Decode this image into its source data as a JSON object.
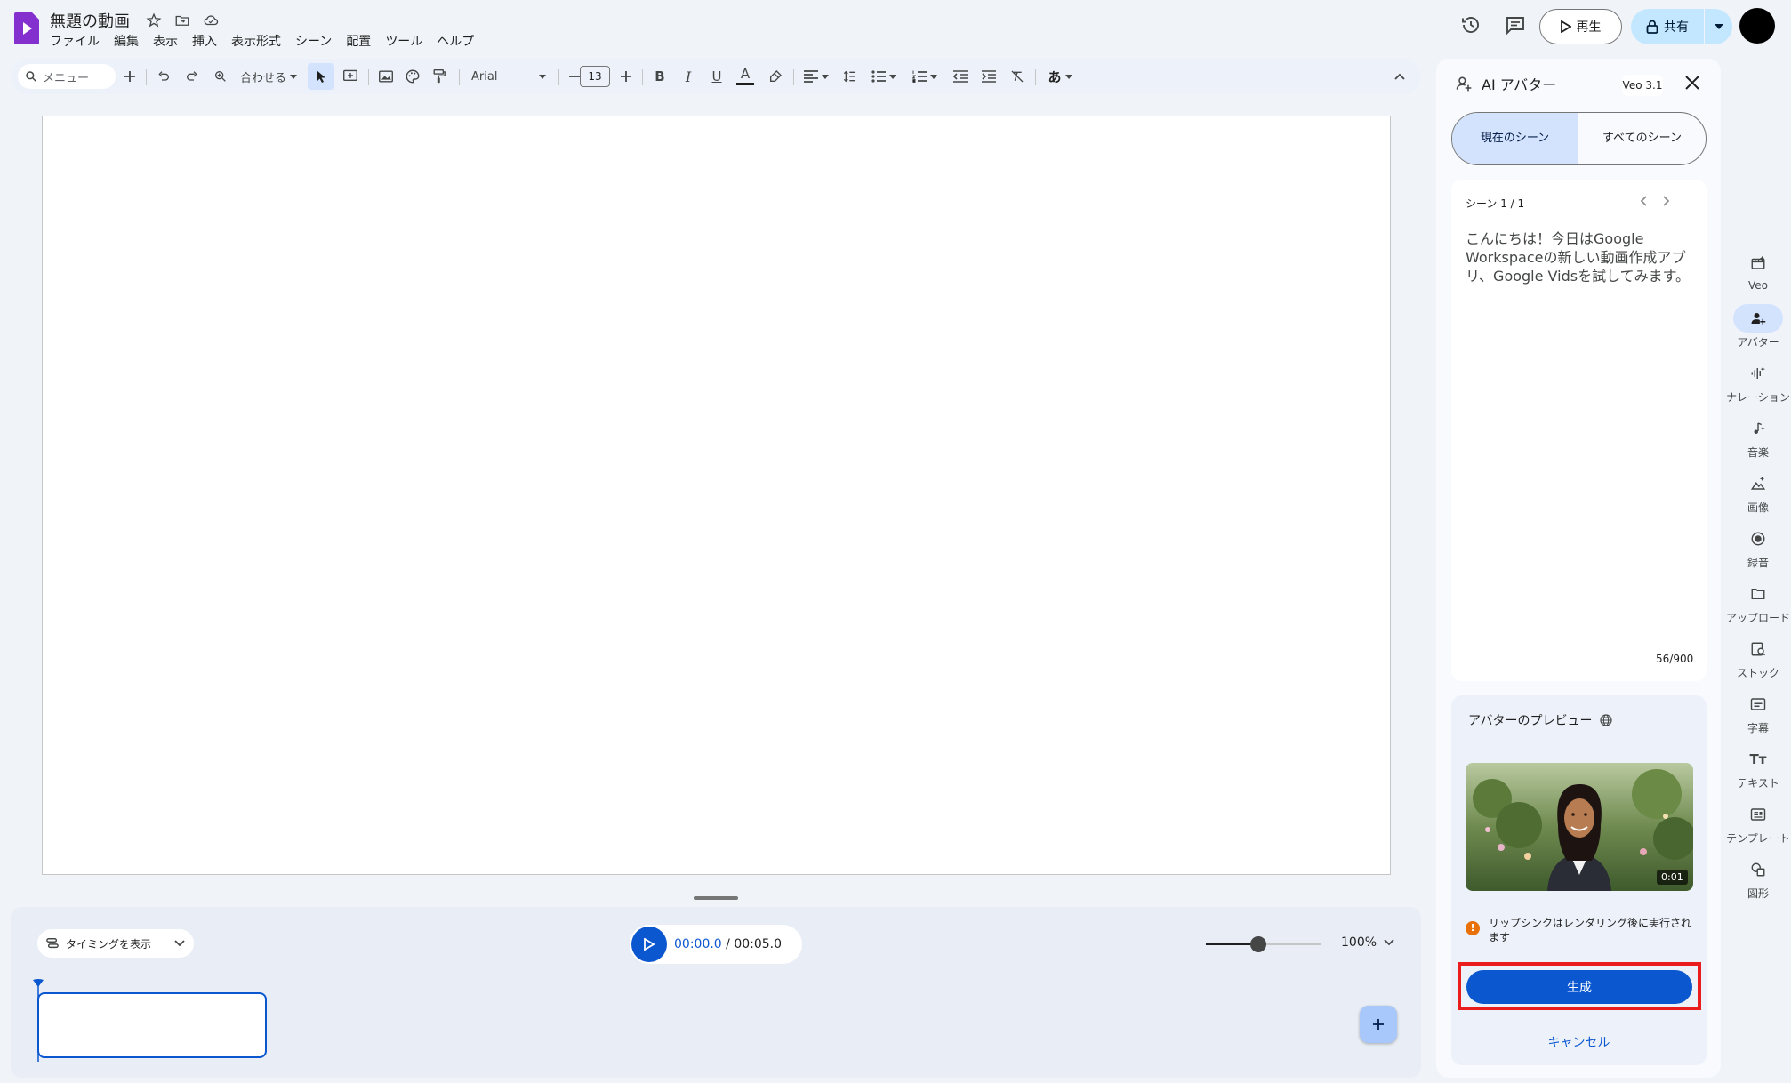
{
  "header": {
    "doc_title": "無題の動画",
    "menu": [
      "ファイル",
      "編集",
      "表示",
      "挿入",
      "表示形式",
      "シーン",
      "配置",
      "ツール",
      "ヘルプ"
    ],
    "play_label": "再生",
    "share_label": "共有"
  },
  "toolbar": {
    "search_placeholder": "メニュー",
    "zoom_fit": "合わせる",
    "font": "Arial",
    "font_size": "13",
    "ime_char": "あ"
  },
  "timeline": {
    "timing_label": "タイミングを表示",
    "current_time": "00:00.0",
    "separator": " / ",
    "total_time": "00:05.0",
    "zoom_percent": "100%",
    "zoom_level": 0.45
  },
  "panel": {
    "title": "AI アバター",
    "badge": "Veo 3.1",
    "tabs": [
      "現在のシーン",
      "すべてのシーン"
    ],
    "scene_label": "シーン 1 / 1",
    "script": "こんにちは！今日はGoogle Workspaceの新しい動画作成アプリ、Google Vidsを試してみます。",
    "char_count": "56/900",
    "preview_title": "アバターのプレビュー",
    "preview_duration": "0:01",
    "warning": "リップシンクはレンダリング後に実行されます",
    "generate_label": "生成",
    "cancel_label": "キャンセル"
  },
  "rail": [
    {
      "label": "Veo",
      "icon": "veo-icon"
    },
    {
      "label": "アバター",
      "icon": "avatar-add-icon",
      "active": true
    },
    {
      "label": "ナレーション",
      "icon": "narration-icon"
    },
    {
      "label": "音楽",
      "icon": "music-icon"
    },
    {
      "label": "画像",
      "icon": "image-sparkle-icon"
    },
    {
      "label": "録音",
      "icon": "record-icon"
    },
    {
      "label": "アップロード",
      "icon": "folder-icon"
    },
    {
      "label": "ストック",
      "icon": "stock-icon"
    },
    {
      "label": "字幕",
      "icon": "captions-icon"
    },
    {
      "label": "テキスト",
      "icon": "text-icon"
    },
    {
      "label": "テンプレート",
      "icon": "template-icon"
    },
    {
      "label": "図形",
      "icon": "shapes-icon"
    }
  ],
  "colors": {
    "accent": "#0b57d0",
    "highlight_frame": "#ea1c1c",
    "logo": "#8430ce"
  }
}
